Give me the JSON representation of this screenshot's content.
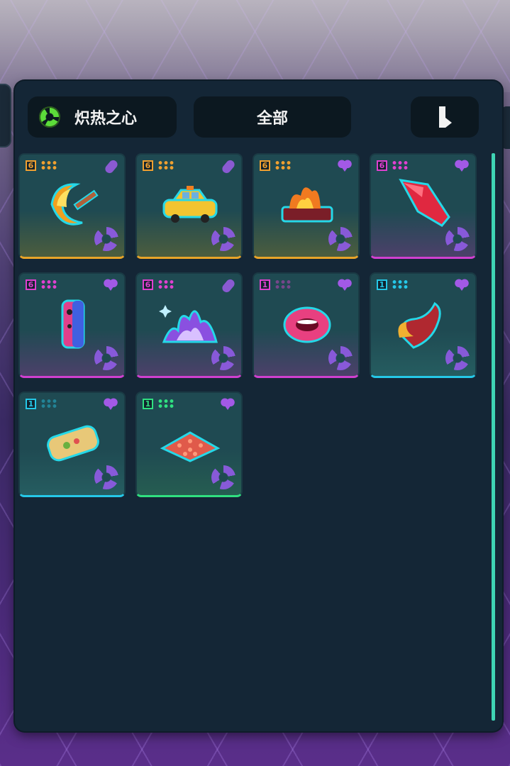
{
  "header": {
    "set_label": "炽热之心",
    "filter_label": "全部"
  },
  "colors": {
    "panel": "#142636",
    "scrollbar": "#3fd4b4",
    "gold_rank": "#f0a030",
    "magenta_rank": "#e040d0",
    "cyan_rank": "#25c8e8",
    "green_rank": "#30e080",
    "favorite": "#a259e6"
  },
  "items": [
    {
      "rank": "6",
      "rarity": "gold",
      "corner": "pill-icon",
      "art": "fire-boomerang-icon"
    },
    {
      "rank": "6",
      "rarity": "gold",
      "corner": "pill-icon",
      "art": "yellow-taxi-icon"
    },
    {
      "rank": "6",
      "rarity": "gold",
      "corner": "heart-icon",
      "art": "burning-log-icon"
    },
    {
      "rank": "6",
      "rarity": "magenta",
      "corner": "heart-icon",
      "art": "red-shard-icon"
    },
    {
      "rank": "6",
      "rarity": "magenta",
      "corner": "heart-icon",
      "art": "game-controller-icon"
    },
    {
      "rank": "6",
      "rarity": "magenta",
      "corner": "pill-icon",
      "art": "purple-flame-icon"
    },
    {
      "rank": "1",
      "rarity": "magenta",
      "corner": "heart-icon",
      "art": "lips-icon"
    },
    {
      "rank": "1",
      "rarity": "cyan",
      "corner": "heart-icon",
      "art": "fire-scorpion-icon"
    },
    {
      "rank": "1",
      "rarity": "cyan",
      "corner": "heart-icon",
      "art": "burrito-icon"
    },
    {
      "rank": "1",
      "rarity": "green",
      "corner": "heart-icon",
      "art": "spike-mat-icon"
    }
  ]
}
